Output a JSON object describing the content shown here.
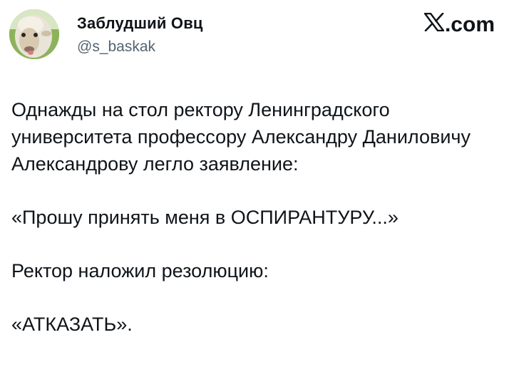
{
  "author": {
    "display_name": "Заблудший Овц",
    "handle": "@s_baskak",
    "avatar_icon": "sheep-avatar"
  },
  "site": {
    "logo_icon": "x-logo-icon",
    "domain_suffix": ".com"
  },
  "tweet": {
    "paragraphs": [
      "Однажды на стол ректору Ленинградского университета профессору Александру Даниловичу Александрову легло заявление:",
      "«Прошу принять меня в ОСПИРАНТУРУ...»",
      "Ректор наложил резолюцию:",
      "«АТКАЗАТЬ»."
    ]
  },
  "colors": {
    "text": "#0f1419",
    "secondary": "#536471"
  }
}
